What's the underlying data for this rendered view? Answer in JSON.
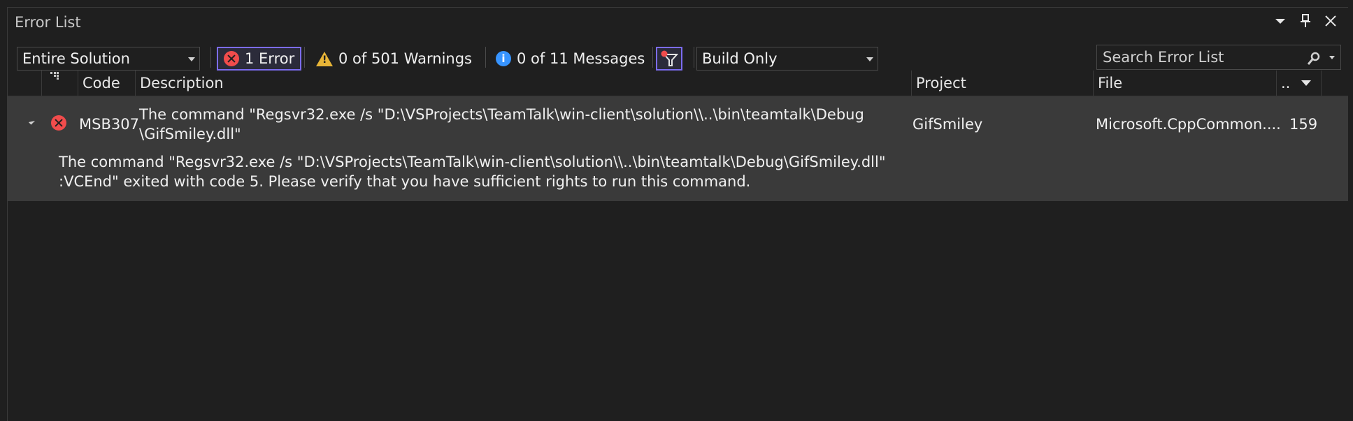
{
  "window": {
    "title": "Error List"
  },
  "toolbar": {
    "scope": "Entire Solution",
    "errors_label": "1 Error",
    "warnings_label": "0 of 501 Warnings",
    "messages_label": "0 of 11 Messages",
    "build_filter": "Build Only",
    "search_placeholder": "Search Error List"
  },
  "columns": {
    "code": "Code",
    "description": "Description",
    "project": "Project",
    "file": "File",
    "line": ".."
  },
  "rows": [
    {
      "code": "MSB307",
      "description_line1": "The command \"Regsvr32.exe /s \"D:\\VSProjects\\TeamTalk\\win-client\\solution\\\\..\\bin\\teamtalk\\Debug",
      "description_line2": "\\GifSmiley.dll\"",
      "project": "GifSmiley",
      "file": "Microsoft.CppCommon....",
      "line": "159",
      "detail_line1": "The command \"Regsvr32.exe /s \"D:\\VSProjects\\TeamTalk\\win-client\\solution\\\\..\\bin\\teamtalk\\Debug\\GifSmiley.dll\"",
      "detail_line2": ":VCEnd\" exited with code 5. Please verify that you have sufficient rights to run this command."
    }
  ],
  "colors": {
    "accent": "#7c6cf2",
    "error": "#f14c4c",
    "warning": "#e8b537",
    "info": "#3794ff"
  }
}
